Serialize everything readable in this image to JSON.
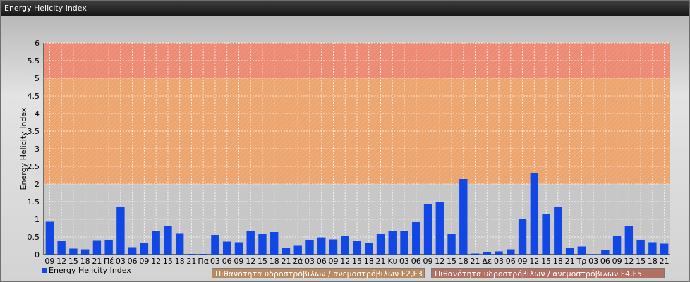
{
  "window": {
    "title": "Energy Helicity Index"
  },
  "chart_data": {
    "type": "bar",
    "ylabel": "Energy Helicity Index",
    "ylim": [
      0,
      6
    ],
    "yticks": [
      "0",
      "0.5",
      "1",
      "1.5",
      "2",
      "2.5",
      "3",
      "3.5",
      "4",
      "4.5",
      "5",
      "5.5",
      "6"
    ],
    "categories": [
      "09",
      "12",
      "15",
      "18",
      "21",
      "Πέ",
      "03",
      "06",
      "09",
      "12",
      "15",
      "18",
      "21",
      "Πα",
      "03",
      "06",
      "09",
      "12",
      "15",
      "18",
      "21",
      "Σά",
      "03",
      "06",
      "09",
      "12",
      "15",
      "18",
      "21",
      "Κυ",
      "03",
      "06",
      "09",
      "12",
      "15",
      "18",
      "21",
      "Δε",
      "03",
      "06",
      "09",
      "12",
      "15",
      "18",
      "21",
      "Τρ",
      "03",
      "06",
      "09",
      "12",
      "15",
      "18",
      "21"
    ],
    "series": [
      {
        "name": "Energy Helicity Index",
        "values": [
          0.93,
          0.38,
          0.17,
          0.15,
          0.39,
          0.4,
          1.34,
          0.19,
          0.34,
          0.67,
          0.81,
          0.59,
          0.02,
          0.02,
          0.54,
          0.37,
          0.35,
          0.66,
          0.58,
          0.64,
          0.18,
          0.25,
          0.41,
          0.49,
          0.43,
          0.52,
          0.38,
          0.33,
          0.58,
          0.66,
          0.66,
          0.92,
          1.42,
          1.49,
          0.58,
          2.14,
          0.03,
          0.06,
          0.09,
          0.15,
          1.0,
          2.3,
          1.16,
          1.36,
          0.18,
          0.23,
          0.0,
          0.12,
          0.52,
          0.81,
          0.4,
          0.35,
          0.31
        ]
      }
    ],
    "bands": [
      {
        "from": 0,
        "to": 2,
        "color": "#c7c7c7",
        "label": ""
      },
      {
        "from": 2,
        "to": 5,
        "color": "#eda56f",
        "label": "Πιθανότητα υδροστρόβιλων / ανεμοστρόβιλων F2,F3"
      },
      {
        "from": 5,
        "to": 6,
        "color": "#ec8a74",
        "label": "Πιθανότητα υδροστρόβιλων / ανεμοστρόβιλων F4,F5"
      }
    ],
    "bar_color": "#1147e5",
    "grid": true,
    "legend": "bottom-left"
  }
}
